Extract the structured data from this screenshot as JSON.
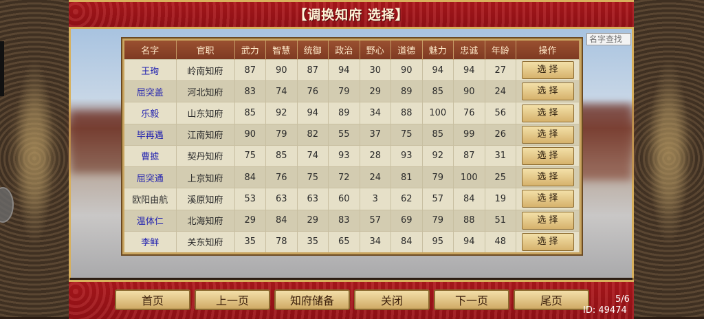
{
  "title": "【调换知府 选择】",
  "search": {
    "placeholder": "名字查找"
  },
  "table": {
    "headers": [
      "名字",
      "官职",
      "武力",
      "智慧",
      "统御",
      "政治",
      "野心",
      "道德",
      "魅力",
      "忠诚",
      "年龄",
      "操作"
    ],
    "rows": [
      {
        "name": "王珣",
        "post": "岭南知府",
        "wu": "87",
        "zhi": "90",
        "tong": "87",
        "zheng": "94",
        "ye": "30",
        "dao": "90",
        "mei": "94",
        "zhong": "94",
        "age": "27",
        "action": "选 择"
      },
      {
        "name": "屈突盖",
        "post": "河北知府",
        "wu": "83",
        "zhi": "74",
        "tong": "76",
        "zheng": "79",
        "ye": "29",
        "dao": "89",
        "mei": "85",
        "zhong": "90",
        "age": "24",
        "action": "选 择"
      },
      {
        "name": "乐毅",
        "post": "山东知府",
        "wu": "85",
        "zhi": "92",
        "tong": "94",
        "zheng": "89",
        "ye": "34",
        "dao": "88",
        "mei": "100",
        "zhong": "76",
        "age": "56",
        "action": "选 择"
      },
      {
        "name": "毕再遇",
        "post": "江南知府",
        "wu": "90",
        "zhi": "79",
        "tong": "82",
        "zheng": "55",
        "ye": "37",
        "dao": "75",
        "mei": "85",
        "zhong": "99",
        "age": "26",
        "action": "选 择"
      },
      {
        "name": "曹摅",
        "post": "契丹知府",
        "wu": "75",
        "zhi": "85",
        "tong": "74",
        "zheng": "93",
        "ye": "28",
        "dao": "93",
        "mei": "92",
        "zhong": "87",
        "age": "31",
        "action": "选 择"
      },
      {
        "name": "屈突通",
        "post": "上京知府",
        "wu": "84",
        "zhi": "76",
        "tong": "75",
        "zheng": "72",
        "ye": "24",
        "dao": "81",
        "mei": "79",
        "zhong": "100",
        "age": "25",
        "action": "选 择"
      },
      {
        "name": "欧阳由航",
        "post": "溪原知府",
        "wu": "53",
        "zhi": "63",
        "tong": "63",
        "zheng": "60",
        "ye": "3",
        "dao": "62",
        "mei": "57",
        "zhong": "84",
        "age": "19",
        "action": "选 择"
      },
      {
        "name": "温体仁",
        "post": "北海知府",
        "wu": "29",
        "zhi": "84",
        "tong": "29",
        "zheng": "83",
        "ye": "57",
        "dao": "69",
        "mei": "79",
        "zhong": "88",
        "age": "51",
        "action": "选 择"
      },
      {
        "name": "李鲜",
        "post": "关东知府",
        "wu": "35",
        "zhi": "78",
        "tong": "35",
        "zheng": "65",
        "ye": "34",
        "dao": "84",
        "mei": "95",
        "zhong": "94",
        "age": "48",
        "action": "选 择"
      }
    ]
  },
  "buttons": {
    "first": "首页",
    "prev": "上一页",
    "reserve": "知府储备",
    "close": "关闭",
    "next": "下一页",
    "last": "尾页"
  },
  "pager": "5/6",
  "user_id": "ID: 49474",
  "colors": {
    "banner_red": "#a3161a",
    "gold_border": "#d8b05c",
    "name_blue": "#2323b0"
  }
}
